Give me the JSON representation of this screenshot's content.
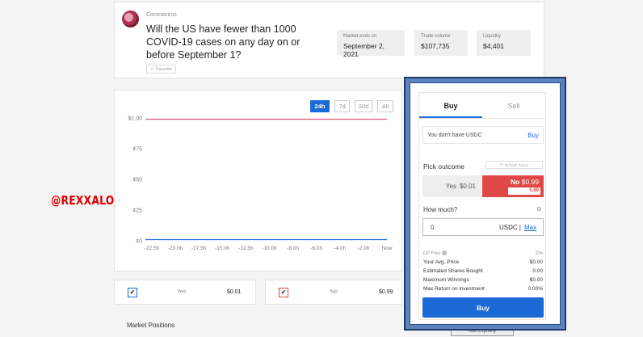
{
  "market": {
    "category": "Coronavirus",
    "question": "Will the US have fewer than 1000 COVID-19 cases on any day on or before September 1?",
    "favorite_label": "Favorite",
    "stats": [
      {
        "label": "Market ends on",
        "value": "September 2, 2021"
      },
      {
        "label": "Trade volume",
        "value": "$107,735"
      },
      {
        "label": "Liquidity",
        "value": "$4,401"
      }
    ]
  },
  "chart": {
    "ranges": [
      {
        "label": "24h",
        "active": true
      },
      {
        "label": "7d",
        "active": false
      },
      {
        "label": "30d",
        "active": false
      },
      {
        "label": "All",
        "active": false
      }
    ],
    "colors": {
      "no_line": "#e05a7a",
      "yes_line": "#1b6ad6"
    }
  },
  "chart_data": {
    "type": "line",
    "x": [
      "-22.5h",
      "-20.0h",
      "-17.5h",
      "-15.0h",
      "-12.5h",
      "-10.0h",
      "-8.0h",
      "-6.0h",
      "-4.0h",
      "-2.0h",
      "Now"
    ],
    "yticks": [
      "$1.00",
      "¢75",
      "¢50",
      "¢25",
      "¢0"
    ],
    "ylim": [
      0,
      1
    ],
    "series": [
      {
        "name": "No",
        "values": [
          0.99,
          0.99,
          0.99,
          0.99,
          0.99,
          0.99,
          0.99,
          0.99,
          0.99,
          0.99,
          0.99
        ]
      },
      {
        "name": "Yes",
        "values": [
          0.01,
          0.01,
          0.01,
          0.01,
          0.01,
          0.01,
          0.01,
          0.01,
          0.01,
          0.01,
          0.01
        ]
      }
    ]
  },
  "outcomes": [
    {
      "name": "Yes",
      "price": "$0.01",
      "check": "✔"
    },
    {
      "name": "No",
      "price": "$0.99",
      "check": "✔"
    }
  ],
  "positions": {
    "title": "Market Positions",
    "partial_button": "Add Liquidity"
  },
  "watermark": "@REXXALO",
  "trade": {
    "tabs": [
      "Buy",
      "Sell"
    ],
    "usdc_message": "You don't have USDC",
    "usdc_buy": "Buy",
    "pick_label": "Pick outcome",
    "refresh_label": "Refresh Prices",
    "yes_option": {
      "label": "Yes",
      "price": "$0.01"
    },
    "no_option": {
      "label": "No",
      "price": "$0.99",
      "sub": "0.99"
    },
    "how_much_label": "How much?",
    "amount_value": "0",
    "currency": "USDC |",
    "max_label": "Max",
    "rows": [
      {
        "label": "LP Fee",
        "value": "2%"
      },
      {
        "label": "Your Avg. Price",
        "value": "$0.00"
      },
      {
        "label": "Estimated Shares Bought",
        "value": "0.00"
      },
      {
        "label": "Maximum Winnings",
        "value": "$0.00"
      },
      {
        "label": "Max Return on investment",
        "value": "0.00%"
      }
    ],
    "buy_button": "Buy"
  }
}
